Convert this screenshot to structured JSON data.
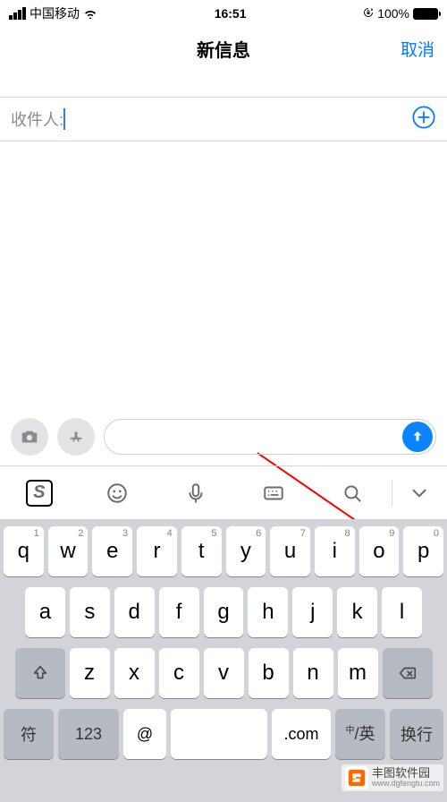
{
  "status": {
    "carrier": "中国移动",
    "time": "16:51",
    "battery_pct": "100%"
  },
  "nav": {
    "title": "新信息",
    "cancel": "取消"
  },
  "recipient": {
    "label": "收件人:",
    "value": ""
  },
  "compose": {
    "message": ""
  },
  "keyboard": {
    "row1": [
      {
        "letter": "q",
        "digit": "1"
      },
      {
        "letter": "w",
        "digit": "2"
      },
      {
        "letter": "e",
        "digit": "3"
      },
      {
        "letter": "r",
        "digit": "4"
      },
      {
        "letter": "t",
        "digit": "5"
      },
      {
        "letter": "y",
        "digit": "6"
      },
      {
        "letter": "u",
        "digit": "7"
      },
      {
        "letter": "i",
        "digit": "8"
      },
      {
        "letter": "o",
        "digit": "9"
      },
      {
        "letter": "p",
        "digit": "0"
      }
    ],
    "row2": [
      "a",
      "s",
      "d",
      "f",
      "g",
      "h",
      "j",
      "k",
      "l"
    ],
    "row3": [
      "z",
      "x",
      "c",
      "v",
      "b",
      "n",
      "m"
    ],
    "row4": {
      "sym": "符",
      "num": "123",
      "at": "@",
      "space": "",
      "com": ".com",
      "lang_cn": "中",
      "lang_en": "英",
      "go": "换行"
    }
  },
  "watermark": {
    "title": "丰图软件园",
    "url": "www.dgfengtu.com"
  }
}
